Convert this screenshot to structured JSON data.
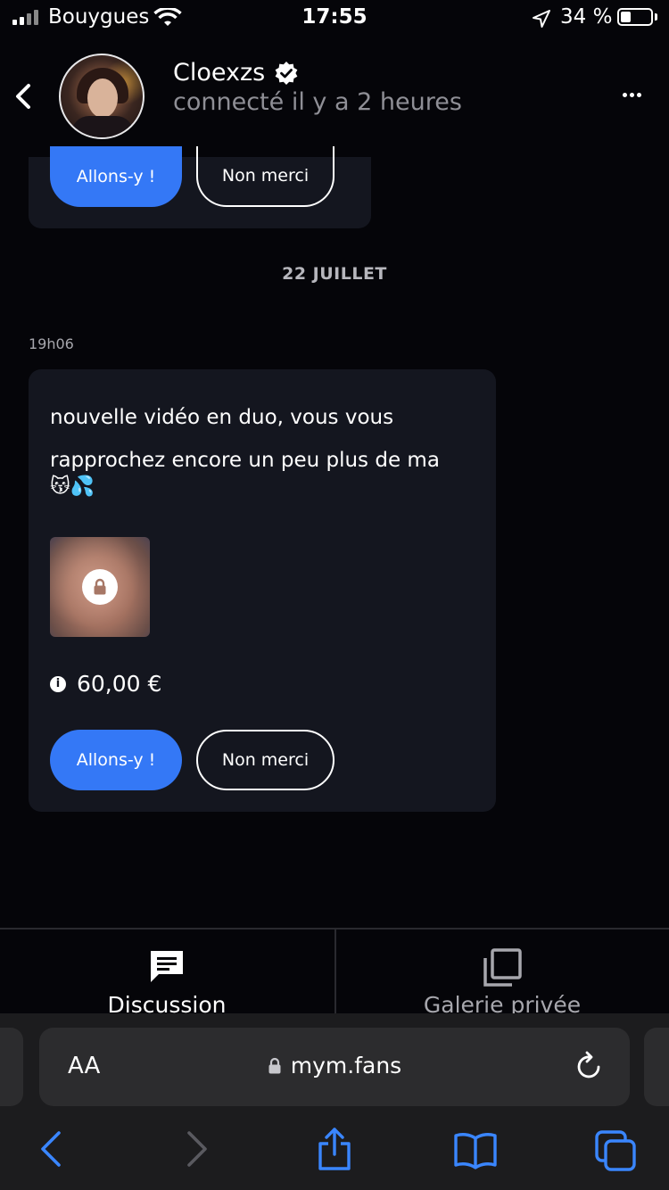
{
  "status_bar": {
    "carrier": "Bouygues",
    "time": "17:55",
    "battery_pct": "34 %",
    "battery_level": 0.34
  },
  "header": {
    "name": "Cloexzs",
    "presence": "connecté il y a 2 heures"
  },
  "top_bubble": {
    "accept_label": "Allons-y !",
    "decline_label": "Non merci"
  },
  "date_separator": "22 JUILLET",
  "message": {
    "time": "19h06",
    "text": "nouvelle vidéo en duo, vous vous rapprochez encore un peu plus de ma",
    "emojis": "😽💦",
    "price": "60,00 €",
    "accept_label": "Allons-y !",
    "decline_label": "Non merci"
  },
  "tabs": [
    {
      "label": "Discussion",
      "active": true
    },
    {
      "label": "Galerie privée",
      "active": false
    }
  ],
  "browser": {
    "aa_label": "AA",
    "url": "mym.fans"
  },
  "colors": {
    "accent": "#3478f6",
    "bubble": "#14161f",
    "background": "#050509",
    "safari_link": "#3a86ff"
  }
}
